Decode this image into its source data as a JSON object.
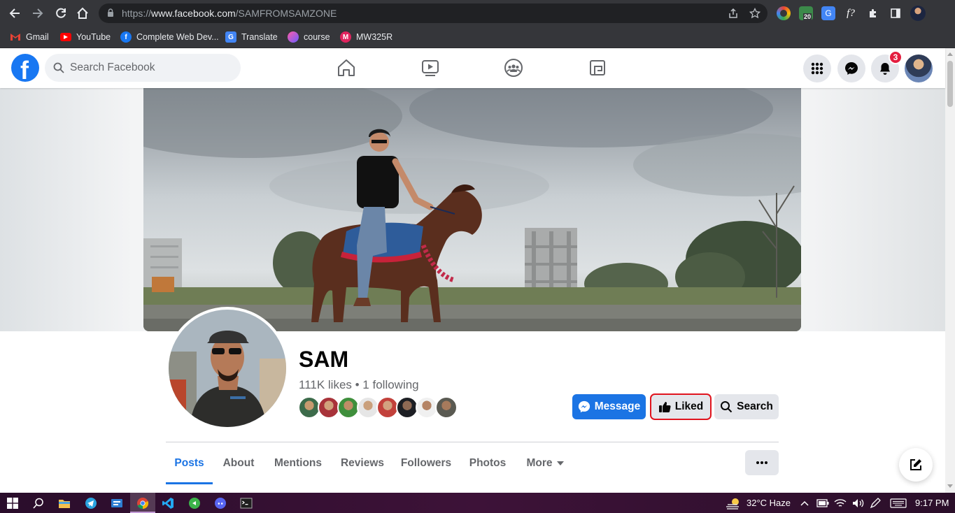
{
  "browser": {
    "url_prefix": "https://",
    "url_domain": "www.facebook.com",
    "url_path": "/SAMFROMSAMZONE",
    "extension_badge": "20",
    "bookmarks": [
      {
        "label": "Gmail",
        "icon": "gmail-icon",
        "color": "#ea4335"
      },
      {
        "label": "YouTube",
        "icon": "youtube-icon",
        "color": "#ff0000"
      },
      {
        "label": "Complete Web Dev...",
        "icon": "facebook-icon",
        "color": "#1877f2"
      },
      {
        "label": "Translate",
        "icon": "google-translate-icon",
        "color": "#4285f4"
      },
      {
        "label": "course",
        "icon": "course-icon",
        "color": "#7b61ff"
      },
      {
        "label": "MW325R",
        "icon": "mw-icon",
        "color": "#e0245e"
      }
    ]
  },
  "fb": {
    "search_placeholder": "Search Facebook",
    "notification_count": "3"
  },
  "page": {
    "name": "SAM",
    "stats": "111K likes • 1 following",
    "buttons": {
      "message": "Message",
      "liked": "Liked",
      "search": "Search"
    },
    "tabs": [
      "Posts",
      "About",
      "Mentions",
      "Reviews",
      "Followers",
      "Photos",
      "More"
    ],
    "active_tab": "Posts",
    "friend_count": 8
  },
  "taskbar": {
    "weather": "32°C  Haze",
    "time": "9:17 PM"
  },
  "colors": {
    "fb_blue": "#1877f2",
    "liked_highlight": "#e0141e",
    "chrome_bg": "#35363a",
    "taskbar_bg": "#3d1238"
  }
}
